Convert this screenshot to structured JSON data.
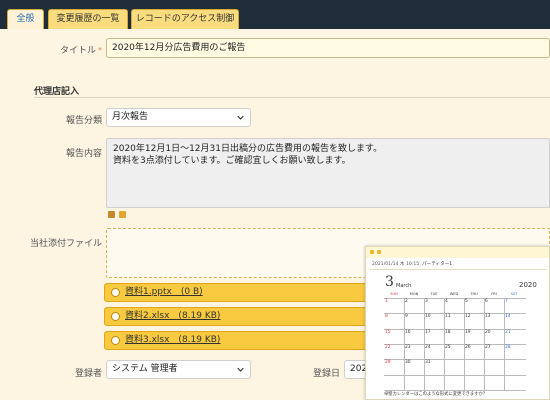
{
  "tabs": [
    {
      "label": "全般",
      "active": true
    },
    {
      "label": "変更履歴の一覧",
      "active": false
    },
    {
      "label": "レコードのアクセス制御",
      "active": false
    }
  ],
  "form": {
    "title_label": "タイトル",
    "required_mark": "*",
    "title_value": "2020年12月分広告費用のご報告",
    "section_agency": "代理店記入",
    "report_type_label": "報告分類",
    "report_type_value": "月次報告",
    "report_content_label": "報告内容",
    "report_content_line1": "2020年12月1日～12月31日出稿分の広告費用の報告を致します。",
    "report_content_line2": "資料を3点添付しています。ご確認宜しくお願い致します。",
    "attachments_label": "当社添付ファイル",
    "attachments": [
      "資料1.pptx　(0 B)",
      "資料2.xlsx　(8.19 KB)",
      "資料3.xlsx　(8.19 KB)"
    ],
    "registrant_label": "登録者",
    "registrant_value": "システム 管理者",
    "registered_date_label": "登録日",
    "registered_date_value": "202"
  },
  "calendar_popup": {
    "meta": "2021/01/14 木 10:15",
    "app_name": "パーティター1",
    "month_number": "3",
    "month_name": "March",
    "year": "2020",
    "weekdays": [
      "SUN",
      "MON",
      "TUE",
      "WED",
      "THU",
      "FRI",
      "SAT"
    ],
    "weeks": [
      [
        "1",
        "2",
        "3",
        "4",
        "5",
        "6",
        "7"
      ],
      [
        "8",
        "9",
        "10",
        "11",
        "12",
        "13",
        "14"
      ],
      [
        "15",
        "16",
        "17",
        "18",
        "19",
        "20",
        "21"
      ],
      [
        "22",
        "23",
        "24",
        "25",
        "26",
        "27",
        "28"
      ],
      [
        "29",
        "30",
        "31",
        "",
        "",
        "",
        ""
      ],
      [
        "",
        "",
        "",
        "",
        "",
        "",
        ""
      ]
    ],
    "footer": "卓壁カレンダーはこのような形式に変更できますか？"
  },
  "colors": {
    "tabbar_bg": "#1f2c3a",
    "tab_bg": "#f8dc7e",
    "tab_active_text": "#2c6db3",
    "panel_bg": "#fdf5e2",
    "attachment_bg": "#f9c93f",
    "sunday": "#d9363e",
    "saturday": "#2f6fd1"
  }
}
